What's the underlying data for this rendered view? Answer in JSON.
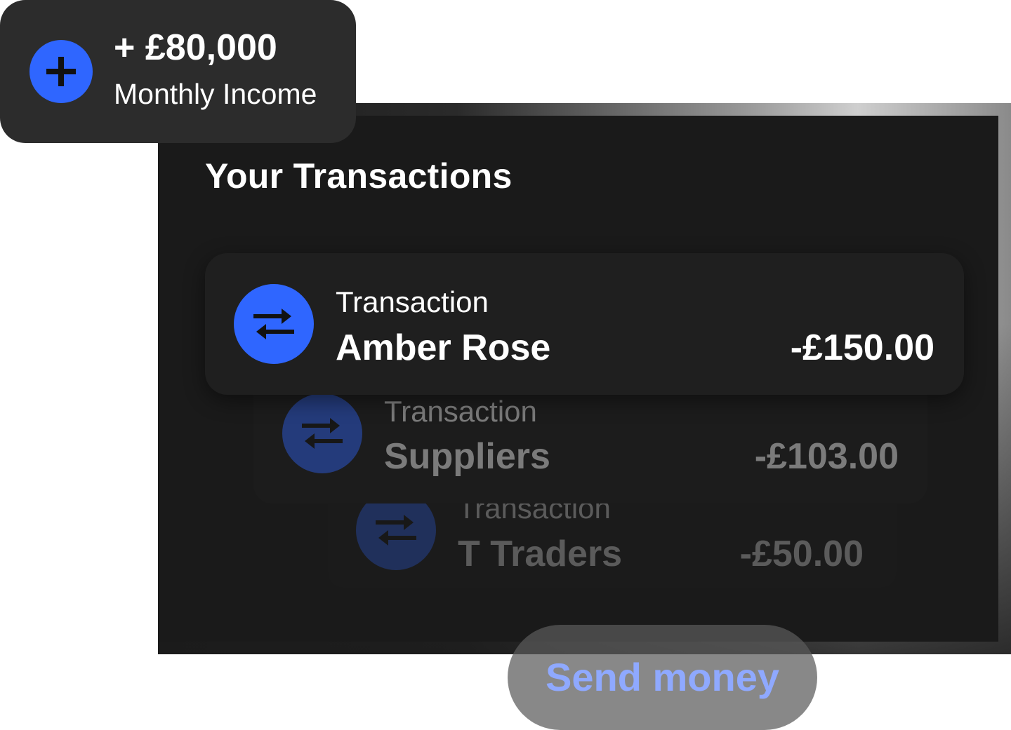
{
  "income": {
    "amount": "+ £80,000",
    "label": "Monthly Income",
    "icon": "plus-icon"
  },
  "panel": {
    "title": "Your Transactions"
  },
  "transactions": [
    {
      "type": "Transaction",
      "name": "Amber Rose",
      "amount": "-£150.00",
      "icon": "transfer-arrows-icon"
    },
    {
      "type": "Transaction",
      "name": "Suppliers",
      "amount": "-£103.00",
      "icon": "transfer-arrows-icon"
    },
    {
      "type": "Transaction",
      "name": "T Traders",
      "amount": "-£50.00",
      "icon": "transfer-arrows-icon"
    }
  ],
  "actions": {
    "send_label": "Send money"
  },
  "colors": {
    "accent": "#2f66ff",
    "panel_bg": "#1a1a1a",
    "card_bg": "#2c2c2c",
    "button_text": "#8fa9ff"
  }
}
